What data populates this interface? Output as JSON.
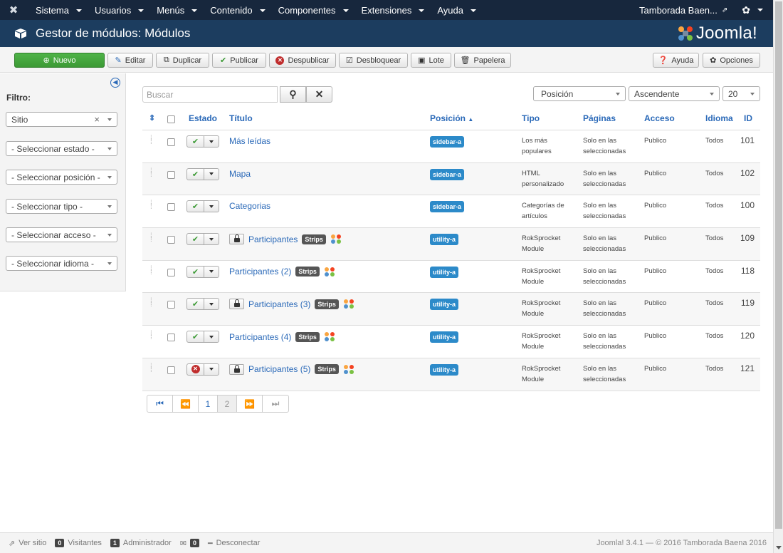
{
  "topnav": {
    "menu": [
      "Sistema",
      "Usuarios",
      "Menús",
      "Contenido",
      "Componentes",
      "Extensiones",
      "Ayuda"
    ],
    "user": "Tamborada Baen..."
  },
  "header": {
    "title": "Gestor de módulos: Módulos",
    "brand": "Joomla!"
  },
  "toolbar": {
    "new": "Nuevo",
    "edit": "Editar",
    "duplicate": "Duplicar",
    "publish": "Publicar",
    "unpublish": "Despublicar",
    "checkin": "Desbloquear",
    "batch": "Lote",
    "trash": "Papelera",
    "help": "Ayuda",
    "options": "Opciones"
  },
  "sidebar": {
    "filter_label": "Filtro:",
    "site_select": "Sitio",
    "filters": [
      "- Seleccionar estado -",
      "- Seleccionar posición -",
      "- Seleccionar tipo -",
      "- Seleccionar acceso -",
      "- Seleccionar idioma -"
    ]
  },
  "search": {
    "placeholder": "Buscar"
  },
  "sorting": {
    "field": "Posición",
    "direction": "Ascendente",
    "limit": "20"
  },
  "table": {
    "headers": {
      "status": "Estado",
      "title": "Título",
      "position": "Posición",
      "type": "Tipo",
      "pages": "Páginas",
      "access": "Acceso",
      "language": "Idioma",
      "id": "ID"
    },
    "rows": [
      {
        "title": "Más leídas",
        "published": true,
        "locked": false,
        "strips": false,
        "position": "sidebar-a",
        "type": "Los más populares",
        "pages": "Solo en las seleccionadas",
        "access": "Publico",
        "language": "Todos",
        "id": "101"
      },
      {
        "title": "Mapa",
        "published": true,
        "locked": false,
        "strips": false,
        "position": "sidebar-a",
        "type": "HTML personalizado",
        "pages": "Solo en las seleccionadas",
        "access": "Publico",
        "language": "Todos",
        "id": "102"
      },
      {
        "title": "Categorias",
        "published": true,
        "locked": false,
        "strips": false,
        "position": "sidebar-a",
        "type": "Categorías de artículos",
        "pages": "Solo en las seleccionadas",
        "access": "Publico",
        "language": "Todos",
        "id": "100"
      },
      {
        "title": "Participantes",
        "published": true,
        "locked": true,
        "strips": true,
        "position": "utility-a",
        "type": "RokSprocket Module",
        "pages": "Solo en las seleccionadas",
        "access": "Publico",
        "language": "Todos",
        "id": "109"
      },
      {
        "title": "Participantes (2)",
        "published": true,
        "locked": false,
        "strips": true,
        "position": "utility-a",
        "type": "RokSprocket Module",
        "pages": "Solo en las seleccionadas",
        "access": "Publico",
        "language": "Todos",
        "id": "118"
      },
      {
        "title": "Participantes (3)",
        "published": true,
        "locked": true,
        "strips": true,
        "position": "utility-a",
        "type": "RokSprocket Module",
        "pages": "Solo en las seleccionadas",
        "access": "Publico",
        "language": "Todos",
        "id": "119"
      },
      {
        "title": "Participantes (4)",
        "published": true,
        "locked": false,
        "strips": true,
        "position": "utility-a",
        "type": "RokSprocket Module",
        "pages": "Solo en las seleccionadas",
        "access": "Publico",
        "language": "Todos",
        "id": "120"
      },
      {
        "title": "Participantes (5)",
        "published": false,
        "locked": true,
        "strips": true,
        "position": "utility-a",
        "type": "RokSprocket Module",
        "pages": "Solo en las seleccionadas",
        "access": "Publico",
        "language": "Todos",
        "id": "121"
      }
    ],
    "badge_label": "Strips"
  },
  "pagination": {
    "pages": [
      "1",
      "2"
    ],
    "current": "2"
  },
  "footer": {
    "view_site": "Ver sitio",
    "visitors_count": "0",
    "visitors": "Visitantes",
    "admin_count": "1",
    "admin": "Administrador",
    "messages_count": "0",
    "logout": "Desconectar",
    "copyright": "Joomla! 3.4.1 — © 2016 Tamborada Baena 2016"
  },
  "colors": {
    "navbar": "#17273d",
    "header": "#1c3d5f",
    "link": "#2a69b8",
    "new_button": "#3c9a35",
    "position_badge": "#2c8ac9"
  }
}
